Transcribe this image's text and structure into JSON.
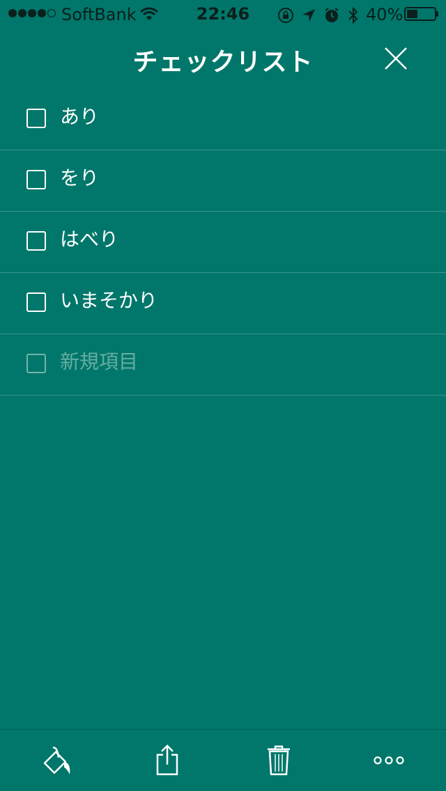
{
  "status_bar": {
    "carrier": "SoftBank",
    "time": "22:46",
    "battery_percent": "40%",
    "battery_level": 0.4,
    "signal_bars_filled": 4,
    "signal_bars_total": 5,
    "icons": [
      "wifi-icon",
      "rotation-lock-icon",
      "location-arrow-icon",
      "alarm-icon",
      "bluetooth-icon",
      "battery-icon"
    ]
  },
  "header": {
    "title": "チェックリスト",
    "close_icon": "close-icon"
  },
  "checklist": {
    "items": [
      {
        "label": "あり",
        "checked": false
      },
      {
        "label": "をり",
        "checked": false
      },
      {
        "label": "はべり",
        "checked": false
      },
      {
        "label": "いまそかり",
        "checked": false
      }
    ],
    "new_item_placeholder": "新規項目"
  },
  "toolbar": {
    "icons": [
      "paint-bucket-icon",
      "share-icon",
      "trash-icon",
      "more-icon"
    ]
  },
  "colors": {
    "background": "#00776A",
    "text": "#FFFFFF",
    "status_text": "#0B1F1C"
  }
}
